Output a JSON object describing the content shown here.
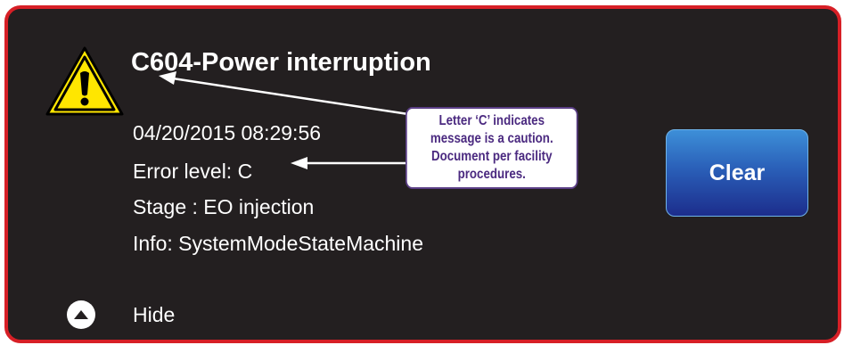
{
  "alarm": {
    "title": "C604-Power interruption",
    "timestamp": "04/20/2015  08:29:56",
    "error_level": "Error level: C",
    "stage": "Stage : EO injection",
    "info": "Info: SystemModeStateMachine"
  },
  "actions": {
    "clear_label": "Clear",
    "hide_label": "Hide"
  },
  "callout": {
    "text": "Letter ‘C’ indicates message is a caution. Document per facility procedures."
  },
  "icons": {
    "warning": "warning-triangle-icon",
    "hide": "chevron-up-circle-icon"
  },
  "colors": {
    "panel_background": "#231f20",
    "panel_border": "#d71f26",
    "warning_yellow": "#ffe600",
    "button_blue": "#2a5fb8",
    "callout_border": "#5b3f86",
    "callout_text": "#4b2a80"
  }
}
